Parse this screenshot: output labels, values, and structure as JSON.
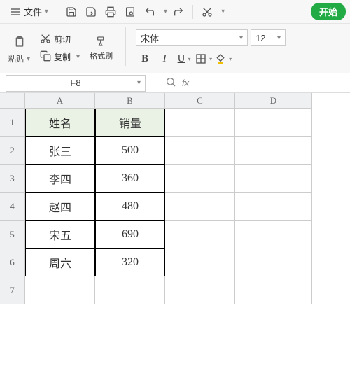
{
  "menu": {
    "file": "文件"
  },
  "start_tab": "开始",
  "clipboard": {
    "paste": "粘贴",
    "cut": "剪切",
    "copy": "复制",
    "format_painter": "格式刷"
  },
  "font": {
    "name": "宋体",
    "size": "12"
  },
  "namebox": "F8",
  "fx": "fx",
  "columns": [
    "A",
    "B",
    "C",
    "D"
  ],
  "rows": [
    "1",
    "2",
    "3",
    "4",
    "5",
    "6",
    "7"
  ],
  "headers": {
    "name": "姓名",
    "sales": "销量"
  },
  "chart_data": {
    "type": "table",
    "columns": [
      "姓名",
      "销量"
    ],
    "records": [
      {
        "name": "张三",
        "sales": "500"
      },
      {
        "name": "李四",
        "sales": "360"
      },
      {
        "name": "赵四",
        "sales": "480"
      },
      {
        "name": "宋五",
        "sales": "690"
      },
      {
        "name": "周六",
        "sales": "320"
      }
    ]
  }
}
